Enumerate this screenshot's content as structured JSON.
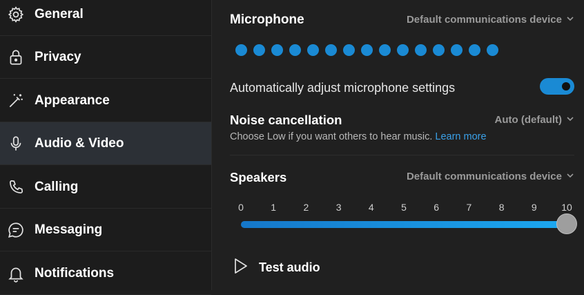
{
  "sidebar": {
    "items": [
      {
        "label": "General",
        "icon": "gear-icon"
      },
      {
        "label": "Privacy",
        "icon": "lock-icon"
      },
      {
        "label": "Appearance",
        "icon": "magic-wand-icon"
      },
      {
        "label": "Audio & Video",
        "icon": "microphone-icon",
        "active": true
      },
      {
        "label": "Calling",
        "icon": "phone-icon"
      },
      {
        "label": "Messaging",
        "icon": "chat-bubble-icon"
      },
      {
        "label": "Notifications",
        "icon": "bell-icon"
      }
    ]
  },
  "microphone": {
    "title": "Microphone",
    "device": "Default communications device",
    "level_dots": 15,
    "auto_adjust_label": "Automatically adjust microphone settings",
    "auto_adjust_on": true
  },
  "noise": {
    "title": "Noise cancellation",
    "value": "Auto (default)",
    "hint": "Choose Low if you want others to hear music.",
    "link": "Learn more"
  },
  "speakers": {
    "title": "Speakers",
    "device": "Default communications device",
    "ticks": [
      "0",
      "1",
      "2",
      "3",
      "4",
      "5",
      "6",
      "7",
      "8",
      "9",
      "10"
    ],
    "volume": 10,
    "max": 10
  },
  "test_audio": {
    "label": "Test audio",
    "icon": "play-icon"
  },
  "colors": {
    "accent": "#1a8ad4",
    "link": "#3aa0e8",
    "background": "#202020",
    "sidebar_active": "#2c3036"
  }
}
